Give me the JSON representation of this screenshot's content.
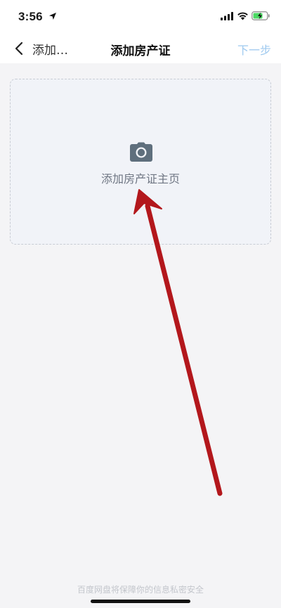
{
  "status_bar": {
    "time": "3:56",
    "icons": [
      "location-arrow-icon",
      "cellular-signal-icon",
      "wifi-icon",
      "battery-charging-icon"
    ],
    "battery_color": "#4cd964"
  },
  "nav": {
    "back_label": "添加…",
    "title": "添加房产证",
    "next_label": "下一步",
    "next_color": "#9ec9ef"
  },
  "upload": {
    "icon": "camera-icon",
    "label": "添加房产证主页"
  },
  "annotation": {
    "type": "arrow",
    "color": "#b3171c"
  },
  "footer": {
    "privacy_text": "百度网盘将保障你的信息私密安全"
  }
}
